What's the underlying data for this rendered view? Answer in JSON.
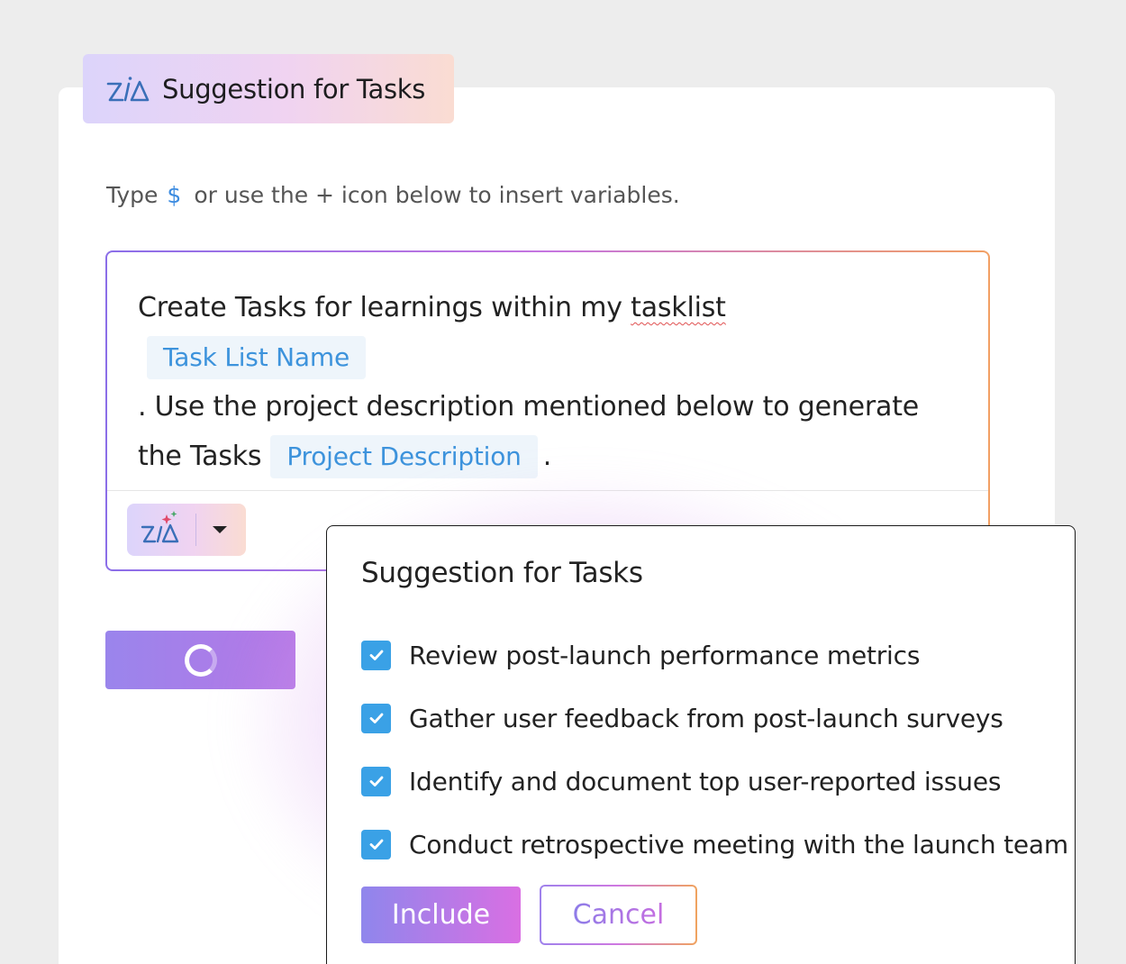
{
  "header": {
    "title": "Suggestion for Tasks",
    "logo_icon": "zia-logo-icon"
  },
  "hint": {
    "prefix": "Type",
    "symbol": "$",
    "suffix": "or use the + icon below to insert variables."
  },
  "editor": {
    "text_1": "Create Tasks for learnings within my",
    "text_misspelled": "tasklist",
    "variable_1": "Task List Name",
    "text_2": ". Use the project description mentioned below to generate the Tasks",
    "variable_2": "Project Description",
    "text_3": "."
  },
  "popup": {
    "title": "Suggestion for Tasks",
    "tasks": [
      {
        "label": "Review post-launch performance metrics",
        "checked": true
      },
      {
        "label": "Gather user feedback from post-launch surveys",
        "checked": true
      },
      {
        "label": "Identify and document top user-reported issues",
        "checked": true
      },
      {
        "label": "Conduct retrospective meeting with the launch team",
        "checked": true
      }
    ],
    "include_label": "Include",
    "cancel_label": "Cancel"
  },
  "colors": {
    "accent_blue": "#3aa1e6",
    "variable_text": "#3d93dc",
    "gradient_start": "#8f86ec",
    "gradient_end": "#d96fe3"
  }
}
